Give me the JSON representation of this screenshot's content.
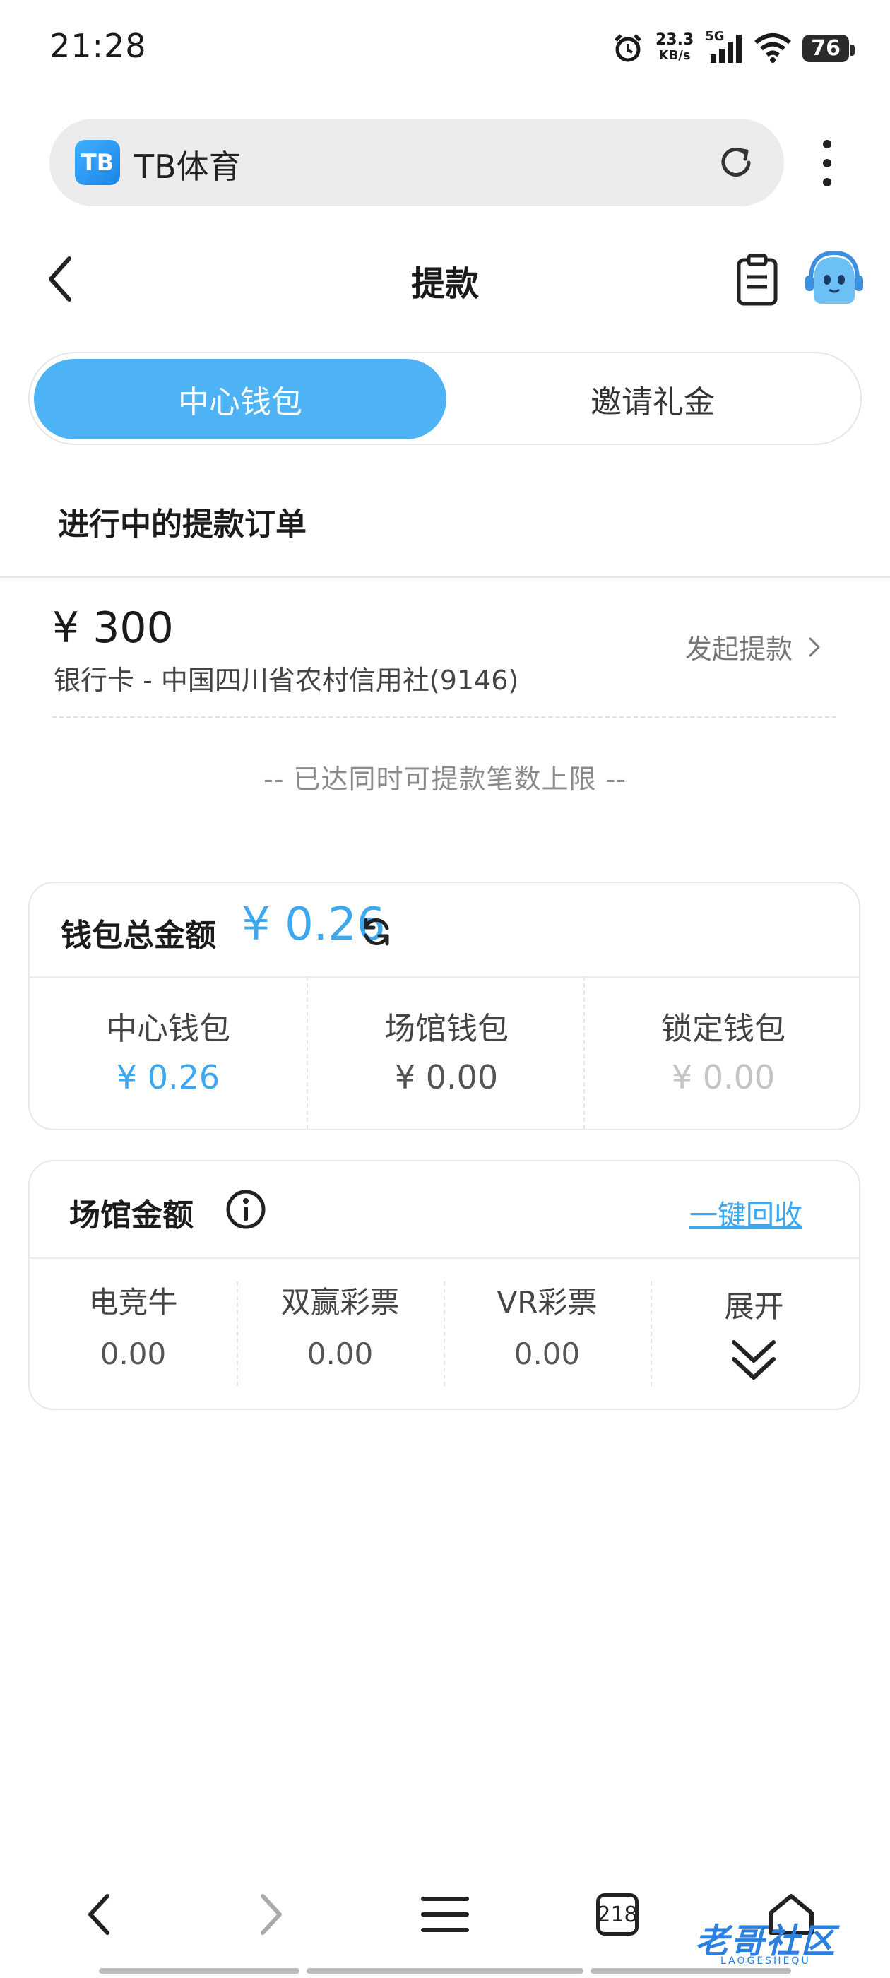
{
  "status_bar": {
    "time": "21:28",
    "net_speed": "23.3",
    "net_unit": "KB/s",
    "network": "5G",
    "battery": "76",
    "icons": [
      "alarm-icon",
      "signal-icon",
      "wifi-icon",
      "battery-icon"
    ]
  },
  "browser": {
    "site_icon_text": "TB",
    "site_title": "TB体育",
    "tab_count": "218"
  },
  "header": {
    "title": "提款"
  },
  "tabs": [
    {
      "label": "中心钱包",
      "active": true
    },
    {
      "label": "邀请礼金",
      "active": false
    }
  ],
  "orders_section": {
    "title": "进行中的提款订单",
    "order": {
      "amount": "¥ 300",
      "bank": "银行卡 - 中国四川省农村信用社(9146)",
      "action": "发起提款"
    },
    "limit_note": "-- 已达同时可提款笔数上限 --"
  },
  "wallet": {
    "label": "钱包总金额",
    "total": "¥ 0.26",
    "cells": [
      {
        "name": "中心钱包",
        "value": "¥ 0.26",
        "color": "#3ca8f0"
      },
      {
        "name": "场馆钱包",
        "value": "¥ 0.00",
        "color": "#555555"
      },
      {
        "name": "锁定钱包",
        "value": "¥ 0.00",
        "color": "#c4c4c4"
      }
    ]
  },
  "venue": {
    "label": "场馆金额",
    "recover_label": "一键回收",
    "cells": [
      {
        "name": "电竞牛",
        "value": "0.00"
      },
      {
        "name": "双赢彩票",
        "value": "0.00"
      },
      {
        "name": "VR彩票",
        "value": "0.00"
      }
    ],
    "expand_label": "展开"
  },
  "watermark": {
    "text": "老哥社区",
    "sub": "LAOGESHEQU"
  },
  "colors": {
    "accent": "#4db3f5",
    "amount_blue": "#3ca8f0"
  }
}
